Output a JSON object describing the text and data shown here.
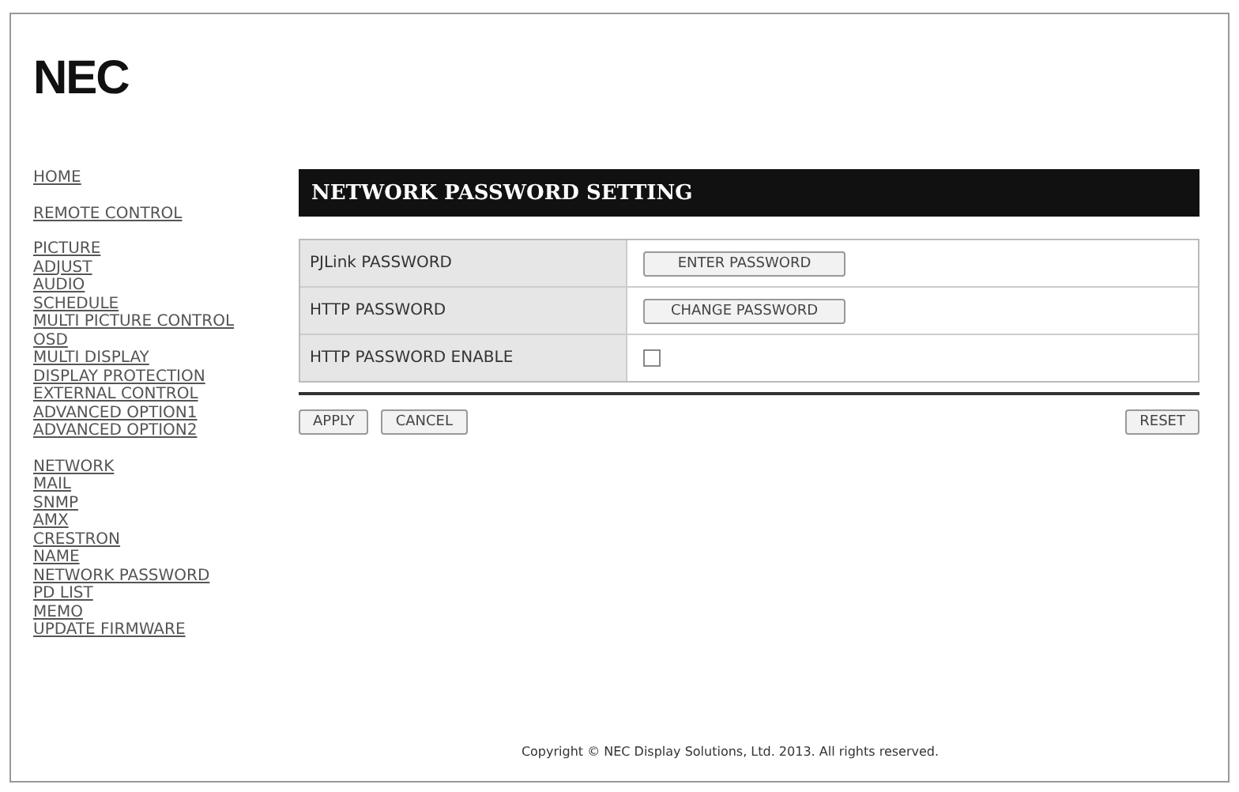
{
  "logo": "NEC",
  "nav_groups": [
    [
      "HOME"
    ],
    [
      "REMOTE CONTROL"
    ],
    [
      "PICTURE",
      "ADJUST",
      "AUDIO",
      "SCHEDULE",
      "MULTI PICTURE CONTROL",
      "OSD",
      "MULTI DISPLAY",
      "DISPLAY PROTECTION",
      "EXTERNAL CONTROL",
      "ADVANCED OPTION1",
      "ADVANCED OPTION2"
    ],
    [
      "NETWORK",
      "MAIL",
      "SNMP",
      "AMX",
      "CRESTRON",
      "NAME",
      "NETWORK PASSWORD",
      "PD LIST",
      "MEMO",
      "UPDATE FIRMWARE"
    ]
  ],
  "title": "NETWORK PASSWORD SETTING",
  "rows": [
    {
      "label": "PJLink PASSWORD",
      "kind": "button",
      "button": "ENTER PASSWORD"
    },
    {
      "label": "HTTP PASSWORD",
      "kind": "button",
      "button": "CHANGE PASSWORD"
    },
    {
      "label": "HTTP PASSWORD ENABLE",
      "kind": "checkbox",
      "checked": false
    }
  ],
  "buttons": [
    "APPLY",
    "CANCEL"
  ],
  "reset": "RESET",
  "copyright": "Copyright © NEC Display Solutions, Ltd. 2013. All rights reserved."
}
